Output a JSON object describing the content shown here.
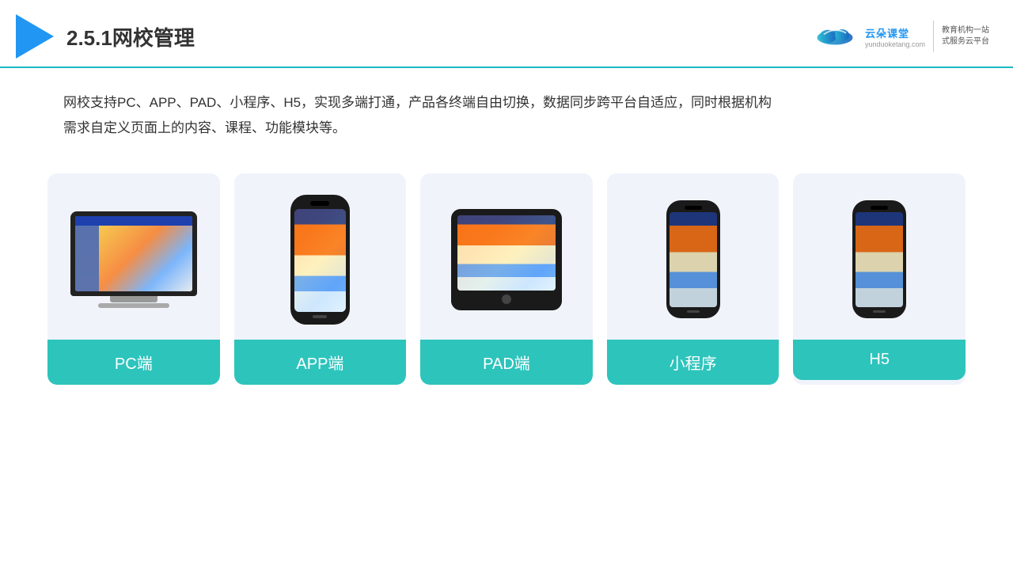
{
  "header": {
    "title": "2.5.1网校管理",
    "brand_name": "云朵课堂",
    "brand_url": "yunduoketang.com",
    "brand_slogan": "教育机构一站\n式服务云平台"
  },
  "description": {
    "text": "网校支持PC、APP、PAD、小程序、H5，实现多端打通，产品各终端自由切换，数据同步跨平台自适应，同时根据机构\n需求自定义页面上的内容、课程、功能模块等。"
  },
  "cards": [
    {
      "id": "pc",
      "label": "PC端",
      "type": "pc"
    },
    {
      "id": "app",
      "label": "APP端",
      "type": "phone"
    },
    {
      "id": "pad",
      "label": "PAD端",
      "type": "tablet"
    },
    {
      "id": "mini-program",
      "label": "小程序",
      "type": "mini-phone"
    },
    {
      "id": "h5",
      "label": "H5",
      "type": "mini-phone2"
    }
  ]
}
